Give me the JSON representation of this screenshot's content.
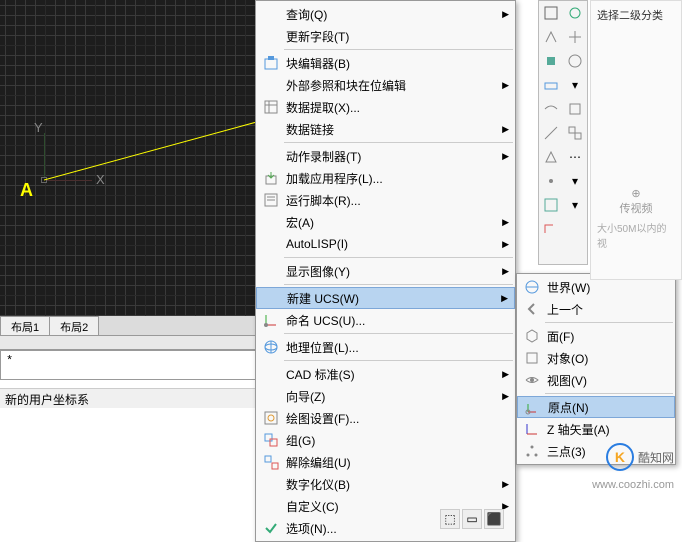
{
  "canvas": {
    "ylabel": "Y",
    "xlabel": "X",
    "point": "A"
  },
  "tabs": [
    "布局1",
    "布局2"
  ],
  "cmdline": "*",
  "statusbar": "新的用户坐标系",
  "menu": [
    {
      "icon": "",
      "label": "查询(Q)",
      "arrow": true
    },
    {
      "icon": "",
      "label": "更新字段(T)"
    },
    {
      "sep": true
    },
    {
      "icon": "block",
      "label": "块编辑器(B)"
    },
    {
      "icon": "",
      "label": "外部参照和块在位编辑",
      "arrow": true
    },
    {
      "icon": "data",
      "label": "数据提取(X)..."
    },
    {
      "icon": "",
      "label": "数据链接",
      "arrow": true
    },
    {
      "sep": true
    },
    {
      "icon": "",
      "label": "动作录制器(T)",
      "arrow": true
    },
    {
      "icon": "load",
      "label": "加载应用程序(L)..."
    },
    {
      "icon": "script",
      "label": "运行脚本(R)..."
    },
    {
      "icon": "",
      "label": "宏(A)",
      "arrow": true
    },
    {
      "icon": "",
      "label": "AutoLISP(I)",
      "arrow": true
    },
    {
      "sep": true
    },
    {
      "icon": "",
      "label": "显示图像(Y)",
      "arrow": true
    },
    {
      "sep": true
    },
    {
      "icon": "",
      "label": "新建 UCS(W)",
      "arrow": true,
      "sel": true
    },
    {
      "icon": "ucs",
      "label": "命名 UCS(U)..."
    },
    {
      "sep": true
    },
    {
      "icon": "geo",
      "label": "地理位置(L)..."
    },
    {
      "sep": true
    },
    {
      "icon": "",
      "label": "CAD 标准(S)",
      "arrow": true
    },
    {
      "icon": "",
      "label": "向导(Z)",
      "arrow": true
    },
    {
      "icon": "draft",
      "label": "绘图设置(F)..."
    },
    {
      "icon": "group",
      "label": "组(G)"
    },
    {
      "icon": "ungroup",
      "label": "解除编组(U)"
    },
    {
      "icon": "",
      "label": "数字化仪(B)",
      "arrow": true
    },
    {
      "icon": "",
      "label": "自定义(C)",
      "arrow": true
    },
    {
      "icon": "check",
      "label": "选项(N)..."
    }
  ],
  "submenu": [
    {
      "icon": "world",
      "label": "世界(W)"
    },
    {
      "icon": "prev",
      "label": "上一个"
    },
    {
      "sep": true
    },
    {
      "icon": "face",
      "label": "面(F)"
    },
    {
      "icon": "obj",
      "label": "对象(O)"
    },
    {
      "icon": "view",
      "label": "视图(V)"
    },
    {
      "sep": true
    },
    {
      "icon": "origin",
      "label": "原点(N)",
      "sel": true
    },
    {
      "icon": "zaxis",
      "label": "Z 轴矢量(A)"
    },
    {
      "icon": "three",
      "label": "三点(3)"
    }
  ],
  "rpanel": {
    "header": "选择二级分类",
    "video": "⊕\n传视频",
    "size": "大小50M以内的视"
  },
  "watermark": {
    "brand": "酷知网",
    "url": "www.coozhi.com",
    "logo": "K"
  }
}
